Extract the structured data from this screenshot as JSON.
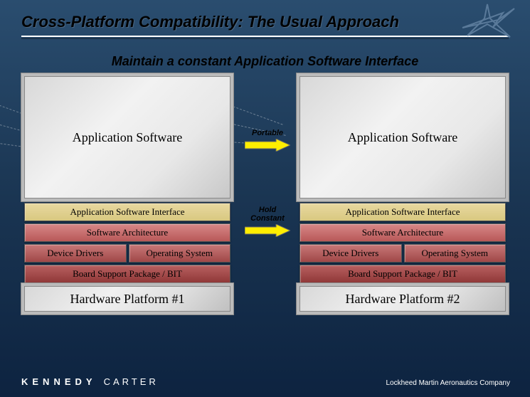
{
  "title": "Cross-Platform Compatibility: The Usual Approach",
  "subtitle": "Maintain a constant Application Software Interface",
  "arrows": {
    "portable": "Portable",
    "hold_constant": "Hold\nConstant"
  },
  "left": {
    "app": "Application Software",
    "iface": "Application Software Interface",
    "arch": "Software Architecture",
    "drivers": "Device Drivers",
    "os": "Operating System",
    "bsp": "Board Support Package / BIT",
    "hw": "Hardware Platform #1"
  },
  "right": {
    "app": "Application Software",
    "iface": "Application Software Interface",
    "arch": "Software Architecture",
    "drivers": "Device Drivers",
    "os": "Operating System",
    "bsp": "Board Support Package / BIT",
    "hw": "Hardware Platform #2"
  },
  "footer": {
    "kennedy": "KENNEDY",
    "carter": "CARTER",
    "company": "Lockheed Martin Aeronautics Company"
  }
}
